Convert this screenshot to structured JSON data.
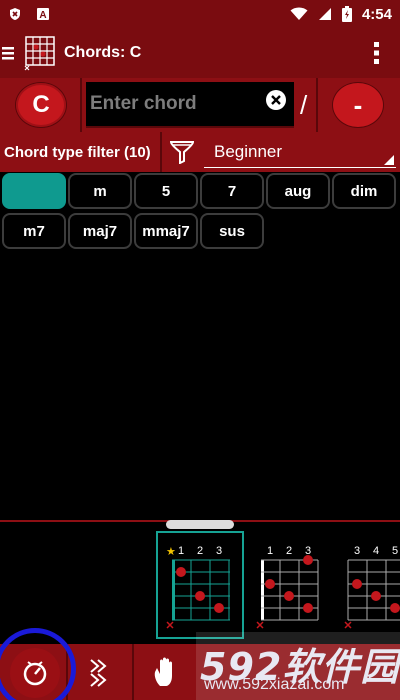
{
  "status_bar": {
    "time": "4:54",
    "icons": [
      "shield-x-icon",
      "font-a-icon",
      "wifi-icon",
      "signal-icon",
      "battery-charging-icon"
    ]
  },
  "app_bar": {
    "title": "Chords: C",
    "menu_icon": "hamburger-icon",
    "overflow_icon": "more-vert-icon"
  },
  "chord_input": {
    "root_label": "C",
    "placeholder": "Enter chord",
    "slash": "/",
    "bass_label": "-"
  },
  "filter": {
    "label": "Chord type filter (10)",
    "selected": "Beginner"
  },
  "chord_types": [
    {
      "label": "",
      "selected": true
    },
    {
      "label": "m"
    },
    {
      "label": "5"
    },
    {
      "label": "7"
    },
    {
      "label": "aug"
    },
    {
      "label": "dim"
    },
    {
      "label": "m7"
    },
    {
      "label": "maj7"
    },
    {
      "label": "mmaj7"
    },
    {
      "label": "sus"
    }
  ],
  "diagrams": [
    {
      "fret_labels": [
        "1",
        "2",
        "3"
      ],
      "star": "★",
      "selected": true
    },
    {
      "fret_labels": [
        "1",
        "2",
        "3"
      ]
    },
    {
      "fret_labels": [
        "3",
        "4",
        "5"
      ]
    }
  ],
  "bottom_nav": {
    "items": [
      "metronome-icon",
      "arrows-icon",
      "hand-icon"
    ]
  },
  "watermark": {
    "main": "592软件园",
    "url": "www.592xiazai.com"
  },
  "colors": {
    "bar": "#8d0f14",
    "accent": "#c4171d",
    "teal": "#0f9a8f"
  }
}
